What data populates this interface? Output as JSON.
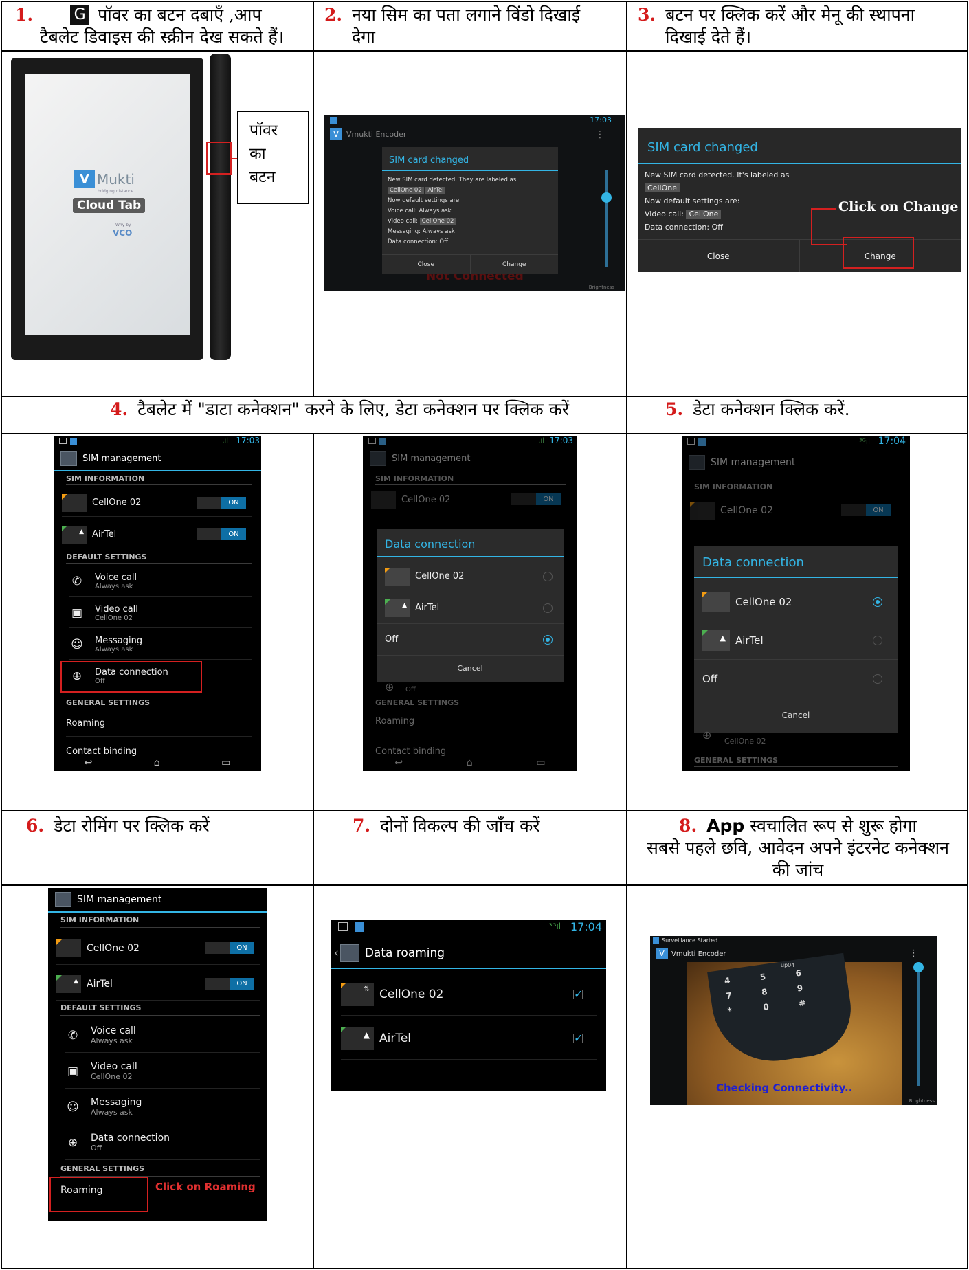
{
  "headers": {
    "h1": {
      "num": "1.",
      "text_a": "पॉवर का बटन दबाएँ ,आप",
      "text_b": "टैबलेट डिवाइस की स्क्रीन देख सकते हैं।"
    },
    "h2": {
      "num": "2.",
      "text_a": "नया सिम का पता लगाने विंडो दिखाई",
      "text_b": "देगा"
    },
    "h3": {
      "num": "3.",
      "text_a": "बटन पर क्लिक करें और मेनू की स्थापना",
      "text_b": "दिखाई देते हैं।"
    },
    "h4": {
      "num": "4.",
      "text": "टैबलेट में \"डाटा कनेक्शन\" करने के लिए, डेटा कनेक्शन पर क्लिक करें"
    },
    "h5": {
      "num": "5.",
      "text": "डेटा कनेक्शन क्लिक करें."
    },
    "h6": {
      "num": "6.",
      "text": "डेटा रोमिंग पर क्लिक करें"
    },
    "h7": {
      "num": "7.",
      "text": "दोनों विकल्प की जाँच करें"
    },
    "h8": {
      "num": "8.",
      "app": "App",
      "text_a": "स्वचालित रूप से शुरू होगा",
      "text_b": "सबसे पहले छवि, आवेदन अपने इंटरनेट कनेक्शन",
      "text_c": "की जांच"
    }
  },
  "tablet": {
    "brand": "Mukti",
    "tagline": "bridging distance",
    "product": "Cloud Tab",
    "maker_small": "Why by",
    "maker": "VCO",
    "power_callout": [
      "पॉवर",
      "का",
      "बटन"
    ]
  },
  "sim_dialog": {
    "time": "17:03",
    "app_title": "Vmukti Encoder",
    "title": "SIM card changed",
    "line1": "New SIM card detected. They are labeled as",
    "tag1": "CellOne 02",
    "tag2": "AirTel",
    "line2": "Now default settings are:",
    "voice": "Voice call:   Always ask",
    "video_label": "Video call:",
    "video_tag": "CellOne 02",
    "messaging": "Messaging:   Always ask",
    "data": "Data connection:   Off",
    "close": "Close",
    "change": "Change",
    "not_connected": "Not Connected",
    "brightness": "Brightness"
  },
  "sim_dialog_zoom": {
    "title": "SIM card changed",
    "line1": "New SIM card detected. It's labeled as",
    "tag": "CellOne",
    "line2": "Now default settings are:",
    "video_label": "Video call:",
    "video_tag": "CellOne",
    "data": "Data connection:   Off",
    "close": "Close",
    "change": "Change",
    "annotation": "Click on Change"
  },
  "sim_mgmt": {
    "time_a": "17:03",
    "time_b": "17:04",
    "title": "SIM management",
    "sec_info": "SIM INFORMATION",
    "sim1": "CellOne 02",
    "sim2": "AirTel",
    "on": "ON",
    "sec_default": "DEFAULT SETTINGS",
    "voice": "Voice call",
    "voice_sub": "Always ask",
    "video": "Video call",
    "video_sub": "CellOne 02",
    "messaging": "Messaging",
    "messaging_sub": "Always ask",
    "data": "Data connection",
    "data_sub": "Off",
    "sec_general": "GENERAL SETTINGS",
    "roaming": "Roaming",
    "contact": "Contact binding",
    "roaming_annotation": "Click on Roaming"
  },
  "data_dialog": {
    "title": "Data connection",
    "opt1": "CellOne 02",
    "opt2": "AirTel",
    "opt3": "Off",
    "cancel": "Cancel",
    "after_sub": "CellOne 02"
  },
  "roaming_screen": {
    "time": "17:04",
    "title": "Data roaming",
    "opt1": "CellOne 02",
    "opt2": "AirTel"
  },
  "camera_screen": {
    "notice": "Surveillance Started",
    "app_title": "Vmukti Encoder",
    "top_label": "up04",
    "status": "Checking Connectivity..",
    "brightness": "Brightness"
  }
}
